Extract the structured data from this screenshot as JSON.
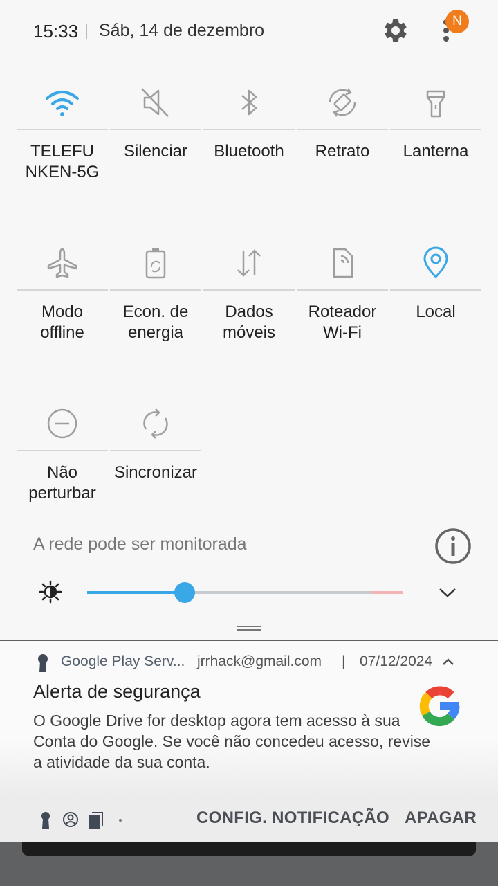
{
  "status": {
    "time": "15:33",
    "date": "Sáb, 14 de dezembro",
    "badge_letter": "N",
    "badge_color": "#f07c1c"
  },
  "quick_tiles": [
    {
      "label": "TELEFU\nNKEN-5G",
      "icon": "wifi-icon",
      "active": true
    },
    {
      "label": "Silenciar",
      "icon": "mute-icon",
      "active": false
    },
    {
      "label": "Bluetooth",
      "icon": "bluetooth-icon",
      "active": false
    },
    {
      "label": "Retrato",
      "icon": "rotate-icon",
      "active": false
    },
    {
      "label": "Lanterna",
      "icon": "flashlight-icon",
      "active": false
    },
    {
      "label": "Modo\noffline",
      "icon": "airplane-icon",
      "active": false
    },
    {
      "label": "Econ. de\nenergia",
      "icon": "battery-saver-icon",
      "active": false
    },
    {
      "label": "Dados\nmóveis",
      "icon": "mobile-data-icon",
      "active": false
    },
    {
      "label": "Roteador\nWi-Fi",
      "icon": "hotspot-icon",
      "active": false
    },
    {
      "label": "Local",
      "icon": "location-icon",
      "active": true
    },
    {
      "label": "Não\nperturbar",
      "icon": "do-not-disturb-icon",
      "active": false
    },
    {
      "label": "Sincronizar",
      "icon": "sync-icon",
      "active": false
    }
  ],
  "network_warning": "A rede pode ser monitorada",
  "brightness": {
    "level": 0.31
  },
  "notification": {
    "app": "Google Play Serv...",
    "account": "jrrhack@gmail.com",
    "separator": "|",
    "date": "07/12/2024",
    "title": "Alerta de segurança",
    "body": "O Google Drive for desktop agora tem acesso à sua Conta do Google. Se você não concedeu acesso, revise a atividade da sua conta."
  },
  "actions": {
    "config": "CONFIG. NOTIFICAÇÃO",
    "clear": "APAGAR"
  },
  "colors": {
    "accent": "#3aa7e6",
    "inactive_icon": "#9e9e9e"
  }
}
